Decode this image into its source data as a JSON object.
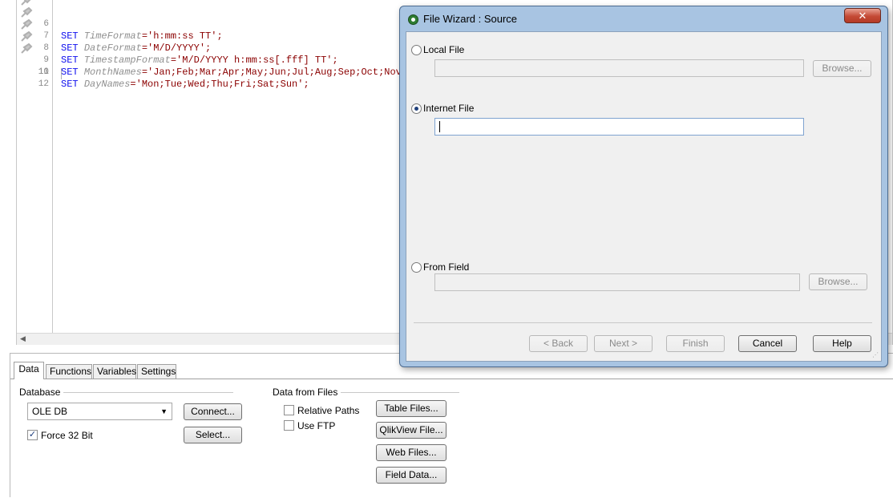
{
  "editor": {
    "lines": [
      {
        "num": "6",
        "kw": "SET",
        "var": "TimeFormat",
        "rest": "='h:mm:ss TT';"
      },
      {
        "num": "7",
        "kw": "SET",
        "var": "DateFormat",
        "rest": "='M/D/YYYY';"
      },
      {
        "num": "8",
        "kw": "SET",
        "var": "TimestampFormat",
        "rest": "='M/D/YYYY h:mm:ss[.fff] TT';"
      },
      {
        "num": "9",
        "kw": "SET",
        "var": "MonthNames",
        "rest": "='Jan;Feb;Mar;Apr;May;Jun;Jul;Aug;Sep;Oct;Nov;Dec';"
      },
      {
        "num": "10",
        "kw": "SET",
        "var": "DayNames",
        "rest": "='Mon;Tue;Wed;Thu;Fri;Sat;Sun';"
      },
      {
        "num": "11",
        "kw": "",
        "var": "",
        "rest": ""
      },
      {
        "num": "12",
        "kw": "",
        "var": "",
        "rest": ""
      }
    ]
  },
  "tabs": [
    "Data",
    "Functions",
    "Variables",
    "Settings"
  ],
  "panel": {
    "database_title": "Database",
    "database_select": "OLE DB",
    "connect_label": "Connect...",
    "select_label": "Select...",
    "force32_label": "Force 32 Bit",
    "force32_checked": true,
    "files_title": "Data from Files",
    "relative_paths_label": "Relative Paths",
    "use_ftp_label": "Use FTP",
    "table_files_label": "Table Files...",
    "qlikview_file_label": "QlikView File...",
    "web_files_label": "Web Files...",
    "field_data_label": "Field Data..."
  },
  "dialog": {
    "title": "File Wizard : Source",
    "close_label": "✕",
    "local_file_label": "Local File",
    "internet_file_label": "Internet File",
    "from_field_label": "From Field",
    "browse_label": "Browse...",
    "internet_value": "",
    "back_label": "< Back",
    "next_label": "Next >",
    "finish_label": "Finish",
    "cancel_label": "Cancel",
    "help_label": "Help",
    "selected_source": "Internet File"
  },
  "colors": {
    "keyword": "#1010ee",
    "variable": "#909090",
    "string": "#8b0000",
    "dialog_frame": "#a8c4e2"
  }
}
